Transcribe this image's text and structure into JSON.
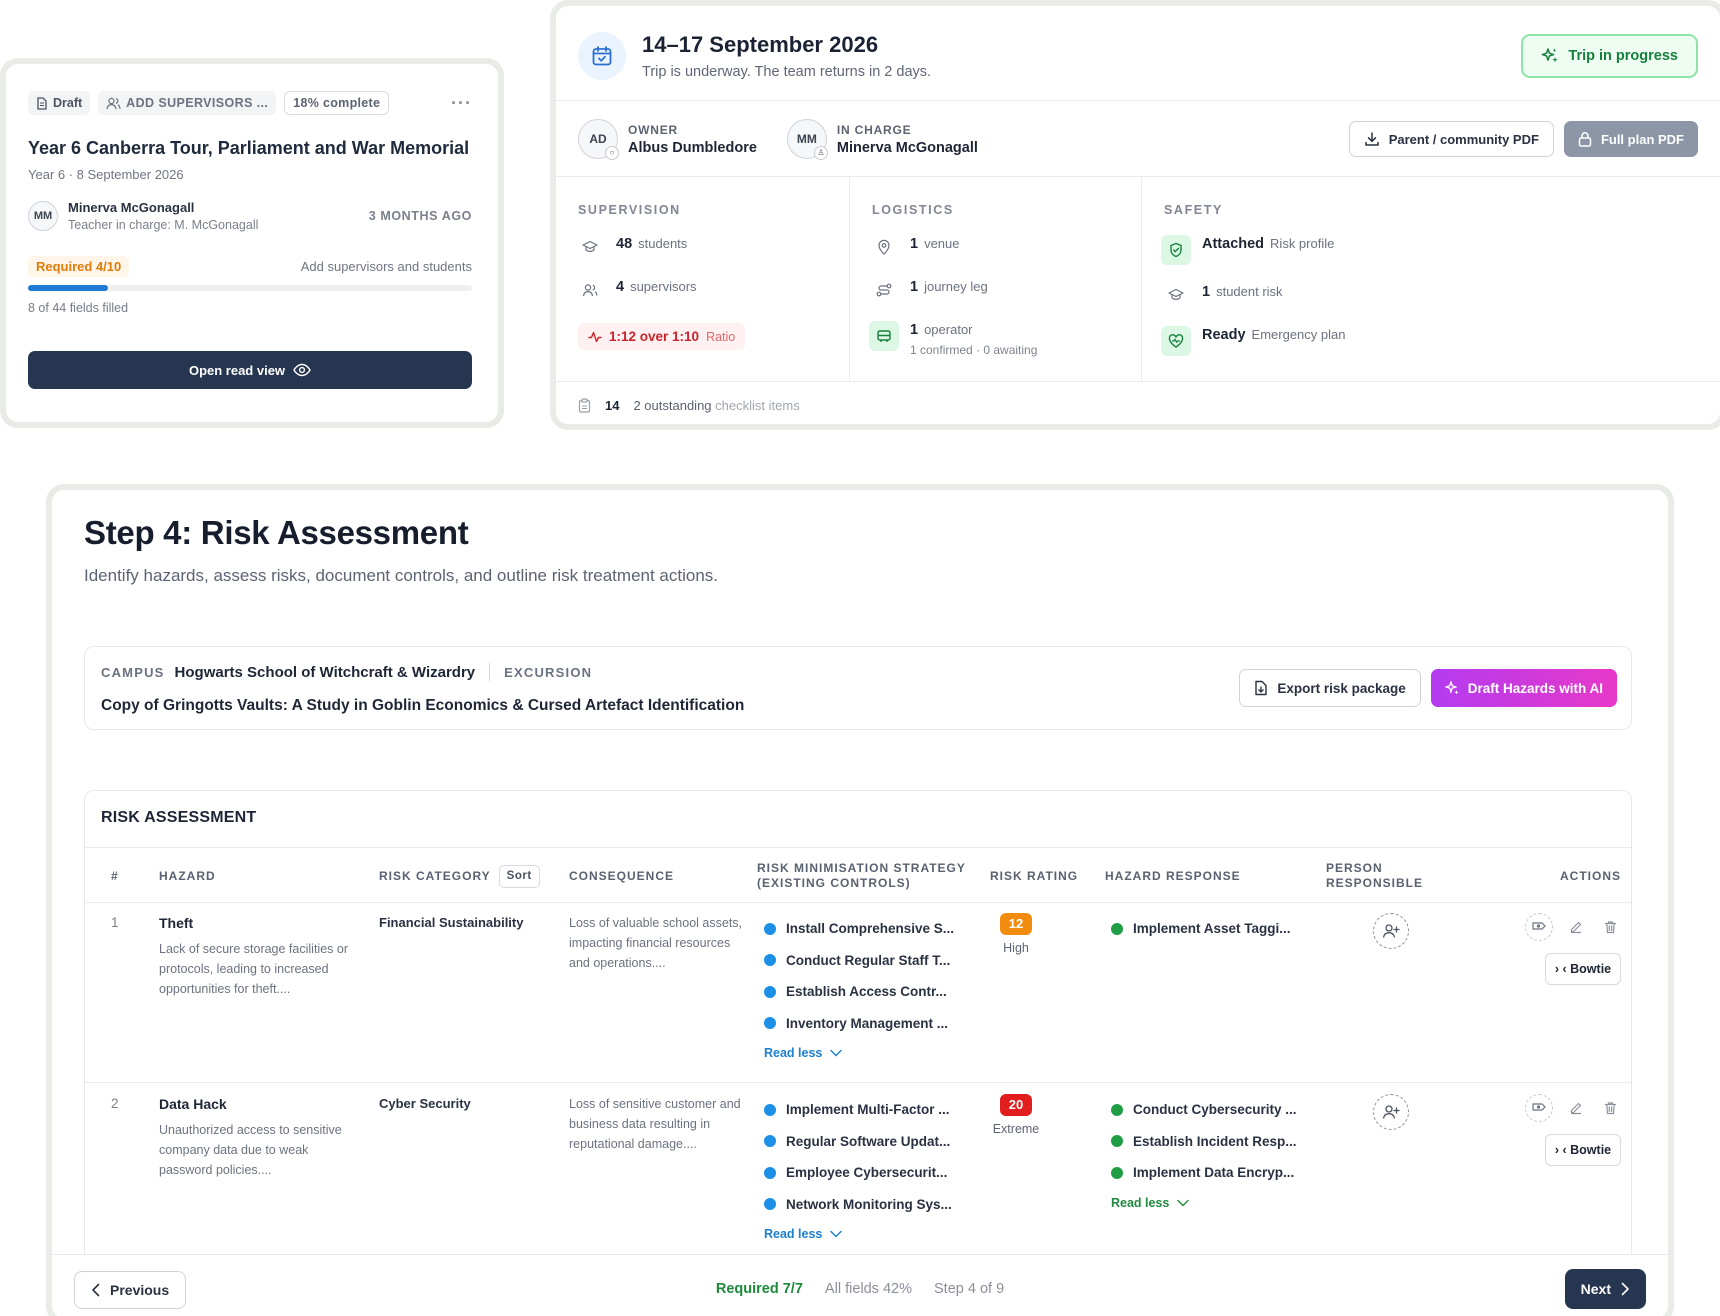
{
  "card_summary": {
    "status_pill": "Draft",
    "supervisors_pill": "ADD SUPERVISORS ...",
    "complete_pill": "18% complete",
    "more_icon": "more-dots-icon",
    "title": "Year 6 Canberra Tour, Parliament and War Memorial",
    "subtitle": "Year 6 · 8 September 2026",
    "person_initials": "MM",
    "person_name": "Minerva McGonagall",
    "person_role": "Teacher in charge: M. McGonagall",
    "updated": "3 MONTHS AGO",
    "required": "Required 4/10",
    "add_hint": "Add supervisors and students",
    "progress_fraction": 0.18,
    "fields_filled": "8 of 44 fields filled",
    "open_button": "Open read view"
  },
  "trip": {
    "dates": "14–17 September 2026",
    "status_text": "Trip is underway. The team returns in 2 days.",
    "status_button": "Trip in progress",
    "owner_initials": "AD",
    "owner_role": "OWNER",
    "owner_name": "Albus Dumbledore",
    "charge_initials": "MM",
    "charge_role": "IN CHARGE",
    "charge_name": "Minerva McGonagall",
    "pdf_parent": "Parent / community PDF",
    "pdf_full": "Full plan PDF",
    "supervision": {
      "title": "SUPERVISION",
      "students_num": "48",
      "students_lbl": "students",
      "supervisors_num": "4",
      "supervisors_lbl": "supervisors",
      "ratio": "1:12 over 1:10",
      "ratio_lbl": "Ratio"
    },
    "logistics": {
      "title": "LOGISTICS",
      "venue_num": "1",
      "venue_lbl": "venue",
      "journey_num": "1",
      "journey_lbl": "journey leg",
      "operator_num": "1",
      "operator_lbl": "operator",
      "operator_sub": "1 confirmed · 0 awaiting"
    },
    "safety": {
      "title": "SAFETY",
      "risk_val": "Attached",
      "risk_lbl": "Risk profile",
      "student_risk_num": "1",
      "student_risk_lbl": "student risk",
      "emergency_val": "Ready",
      "emergency_lbl": "Emergency plan"
    },
    "footer_count": "14",
    "footer_outstanding": "2 outstanding",
    "footer_items": "checklist items"
  },
  "step": {
    "title": "Step 4: Risk Assessment",
    "subtitle": "Identify hazards, assess risks, document controls, and outline risk treatment actions.",
    "campus_label": "CAMPUS",
    "campus_value": "Hogwarts School of Witchcraft & Wizardry",
    "excursion_label": "EXCURSION",
    "excursion_value": "Copy of Gringotts Vaults: A Study in Goblin Economics & Cursed Artefact Identification",
    "export_button": "Export risk package",
    "ai_button": "Draft Hazards with AI"
  },
  "risk_table": {
    "title": "RISK ASSESSMENT",
    "headers": {
      "num": "#",
      "hazard": "HAZARD",
      "category": "RISK CATEGORY",
      "sort": "Sort",
      "consequence": "CONSEQUENCE",
      "strategy_1": "RISK MINIMISATION STRATEGY",
      "strategy_2": "(EXISTING CONTROLS)",
      "rating": "RISK RATING",
      "response": "HAZARD RESPONSE",
      "person_1": "PERSON",
      "person_2": "RESPONSIBLE",
      "actions": "ACTIONS"
    },
    "rows": [
      {
        "num": "1",
        "hazard": "Theft",
        "description": "Lack of secure storage facilities or protocols, leading to increased opportunities for theft....",
        "category": "Financial Sustainability",
        "consequence": "Loss of valuable school assets, impacting financial resources and operations....",
        "controls": [
          "Install Comprehensive S...",
          "Conduct Regular Staff T...",
          "Establish Access Contr...",
          "Inventory Management ..."
        ],
        "controls_toggle": "Read less",
        "rating_score": "12",
        "rating_level": "High",
        "rating_color": "#f28c0f",
        "responses": [
          "Implement Asset Taggi..."
        ],
        "responses_toggle": "",
        "bowtie": "› ‹ Bowtie"
      },
      {
        "num": "2",
        "hazard": "Data Hack",
        "description": "Unauthorized access to sensitive company data due to weak password policies....",
        "category": "Cyber Security",
        "consequence": "Loss of sensitive customer and business data resulting in reputational damage....",
        "controls": [
          "Implement Multi-Factor ...",
          "Regular Software Updat...",
          "Employee Cybersecurit...",
          "Network Monitoring Sys..."
        ],
        "controls_toggle": "Read less",
        "rating_score": "20",
        "rating_level": "Extreme",
        "rating_color": "#e11d1d",
        "responses": [
          "Conduct Cybersecurity ...",
          "Establish Incident Resp...",
          "Implement Data Encryp..."
        ],
        "responses_toggle": "Read less",
        "bowtie": "› ‹ Bowtie"
      }
    ]
  },
  "footer": {
    "previous": "Previous",
    "required": "Required 7/7",
    "all_fields": "All fields 42%",
    "step": "Step 4 of 9",
    "next": "Next"
  },
  "colors": {
    "accent_dark": "#263650",
    "success": "#16803c",
    "danger": "#c9242b",
    "link": "#1c7fd0",
    "ai_gradient_start": "#b43bf0",
    "ai_gradient_end": "#e739c8"
  }
}
